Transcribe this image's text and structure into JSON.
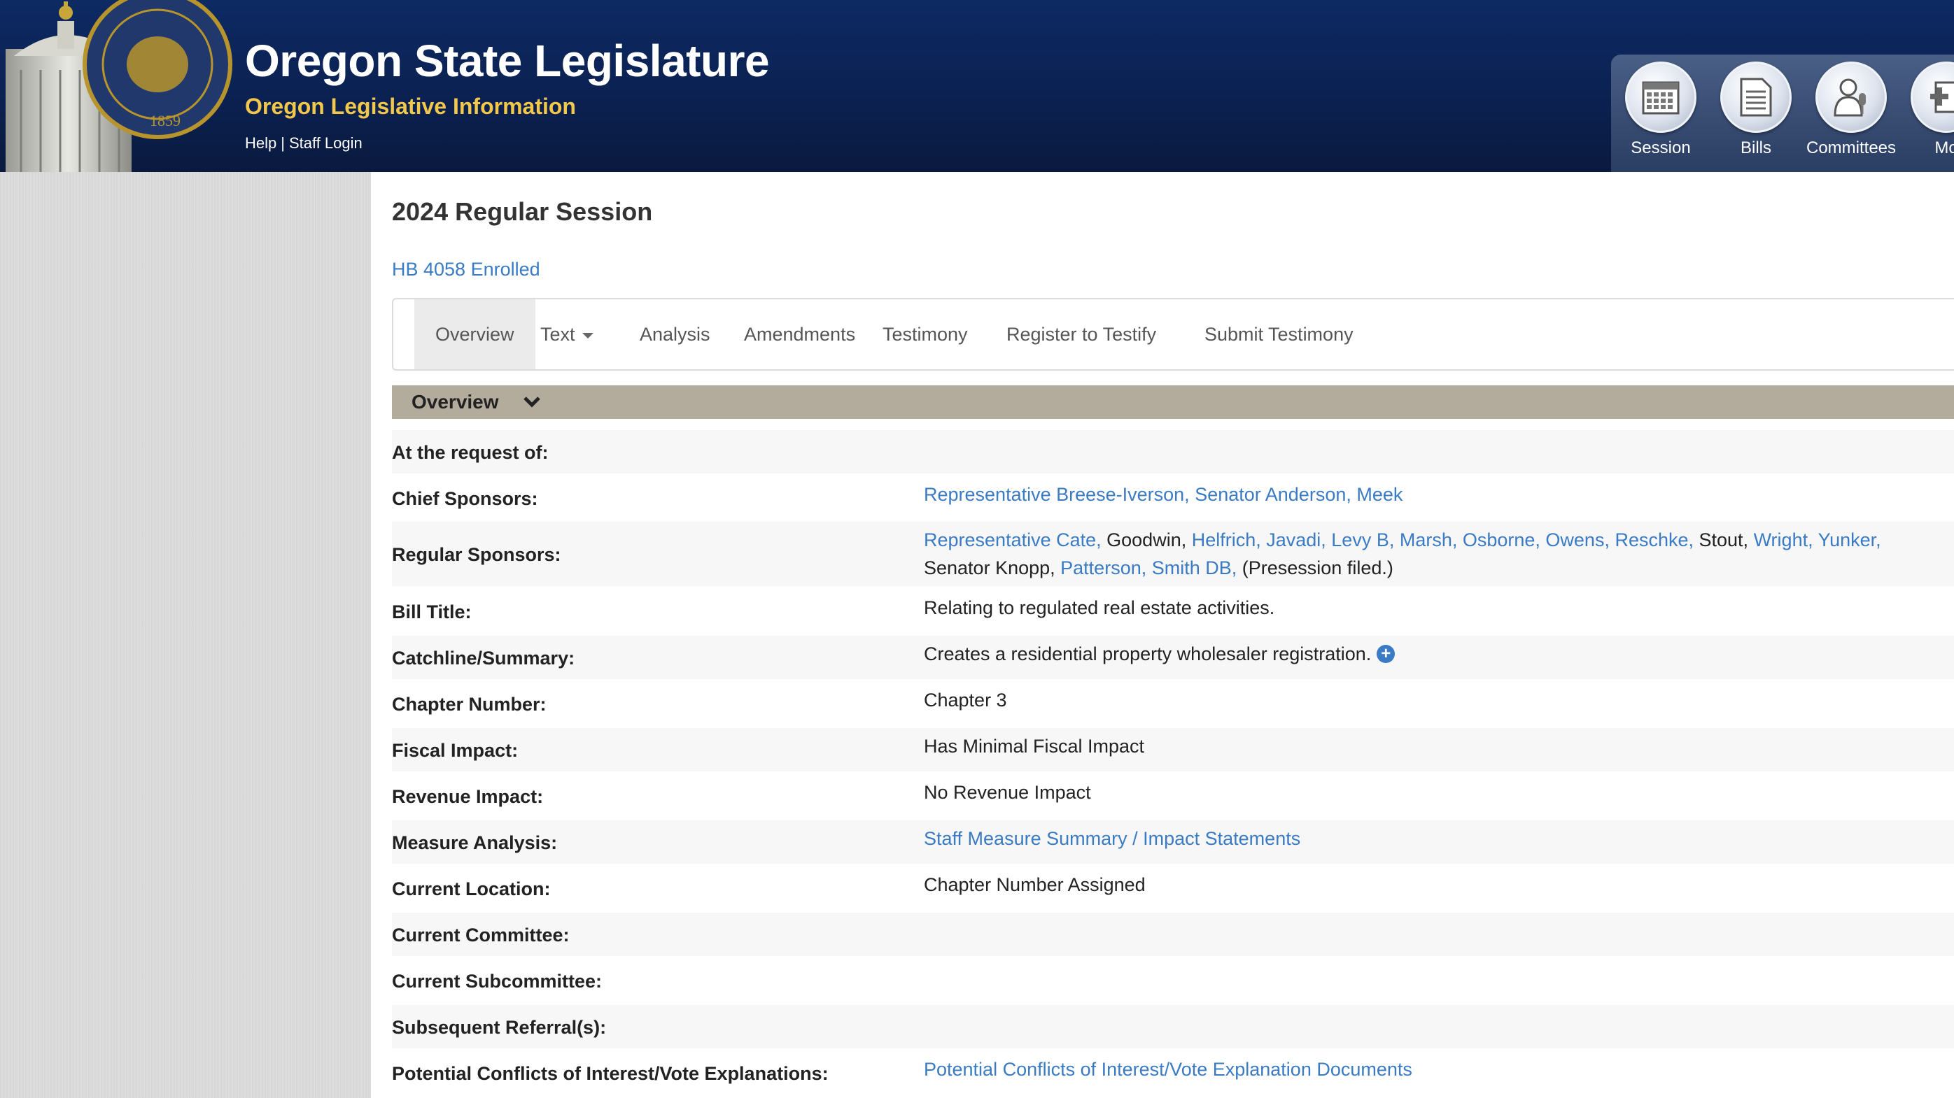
{
  "header": {
    "title": "Oregon State Legislature",
    "subtitle": "Oregon Legislative Information",
    "help_link": "Help",
    "separator": "|",
    "staff_login_link": "Staff Login",
    "nav": [
      {
        "label": "Session",
        "icon": "calendar-icon"
      },
      {
        "label": "Bills",
        "icon": "document-icon"
      },
      {
        "label": "Committees",
        "icon": "committee-person-icon"
      },
      {
        "label": "Mo",
        "icon": "more-icon"
      }
    ],
    "seal_year": "1859"
  },
  "main": {
    "session_title": "2024 Regular Session",
    "bill_link": "HB 4058 Enrolled",
    "tabs": [
      {
        "label": "Overview",
        "active": true
      },
      {
        "label": "Text",
        "dropdown": true
      },
      {
        "label": "Analysis"
      },
      {
        "label": "Amendments"
      },
      {
        "label": "Testimony"
      },
      {
        "label": "Register to Testify"
      },
      {
        "label": "Submit Testimony"
      }
    ],
    "section_label": "Overview",
    "fields": {
      "request_label": "At the request of:",
      "chief_label": "Chief Sponsors:",
      "chief_value": "Representative Breese-Iverson, Senator Anderson, Meek",
      "regular_label": "Regular Sponsors:",
      "regular_line1": {
        "a": "Representative Cate,",
        "b": " Goodwin, ",
        "c": "Helfrich, Javadi, Levy B, Marsh, Osborne, Owens, Reschke,",
        "d": " Stout, ",
        "e": "Wright, Yunker,"
      },
      "regular_line2": {
        "a": "Senator Knopp, ",
        "b": "Patterson, Smith DB,",
        "c": " (Presession filed.)"
      },
      "bill_title_label": "Bill Title:",
      "bill_title_value": "Relating to regulated real estate activities.",
      "catchline_label": "Catchline/Summary:",
      "catchline_value": "Creates a residential property wholesaler registration.",
      "chapter_label": "Chapter Number:",
      "chapter_value": "Chapter 3",
      "fiscal_label": "Fiscal Impact:",
      "fiscal_value": "Has Minimal Fiscal Impact",
      "revenue_label": "Revenue Impact:",
      "revenue_value": "No Revenue Impact",
      "measure_label": "Measure Analysis:",
      "measure_value": "Staff Measure Summary / Impact Statements",
      "location_label": "Current Location:",
      "location_value": "Chapter Number Assigned",
      "committee_label": "Current Committee:",
      "subcommittee_label": "Current Subcommittee:",
      "referral_label": "Subsequent Referral(s):",
      "conflicts_label": "Potential Conflicts of Interest/Vote Explanations:",
      "conflicts_value": "Potential Conflicts of Interest/Vote Explanation Documents"
    }
  },
  "colors": {
    "header_bg": "#0b2152",
    "subtitle": "#f2c84b",
    "link": "#3a7bc4",
    "section_bar": "#b3ab9c"
  }
}
